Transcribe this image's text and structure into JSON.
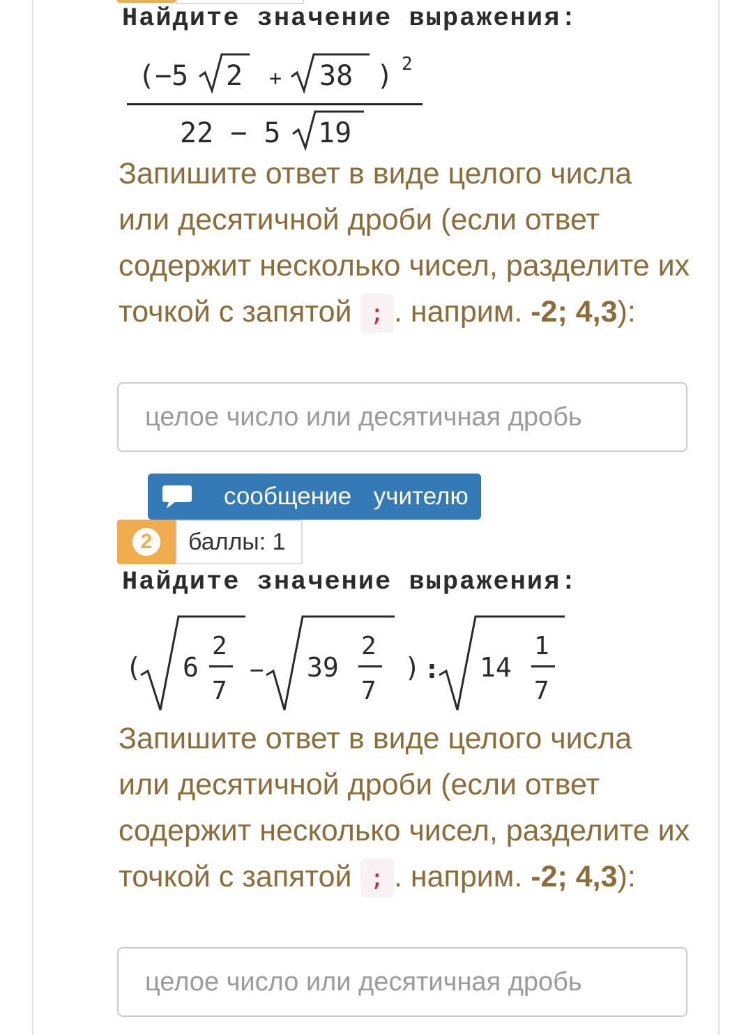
{
  "question1": {
    "prompt": "Найдите значение выражения:",
    "expression": {
      "numerator": [
        "(−5",
        "2",
        "+",
        "38",
        ")",
        "2"
      ],
      "denominator": [
        "22 − 5",
        "19"
      ]
    },
    "instruction": {
      "text1": "Запишите ответ в виде целого числа или десятичной дроби (если ответ содержит несколько чисел, разделите их точкой с запятой ",
      "code": ";",
      "text2": ". наприм. ",
      "example": "-2; 4,3",
      "text3": "):"
    },
    "answer_placeholder": "целое число или десятичная дробь"
  },
  "message_button": {
    "label": "сообщение учителю",
    "icon": "chat-bubble-icon"
  },
  "question2": {
    "number": "2",
    "score": "баллы: 1",
    "prompt": "Найдите значение выражения:",
    "expression": {
      "open": "(",
      "t1_whole": "6",
      "t1_num": "2",
      "t1_den": "7",
      "minus": "−",
      "t2_whole": "39",
      "t2_num": "2",
      "t2_den": "7",
      "close": ")",
      "colon": ":",
      "t3_whole": "14",
      "t3_num": "1",
      "t3_den": "7"
    },
    "instruction": {
      "text1": "Запишите ответ в виде целого числа или десятичной дроби (если ответ содержит несколько чисел, разделите их точкой с запятой ",
      "code": ";",
      "text2": ". наприм. ",
      "example": "-2; 4,3",
      "text3": "):"
    },
    "answer_placeholder": "целое число или десятичная дробь"
  },
  "colors": {
    "instruction_text": "#8a6d3b",
    "button_blue": "#337ab7",
    "badge_orange": "#f0ad4e",
    "code_red": "#c7254e"
  }
}
